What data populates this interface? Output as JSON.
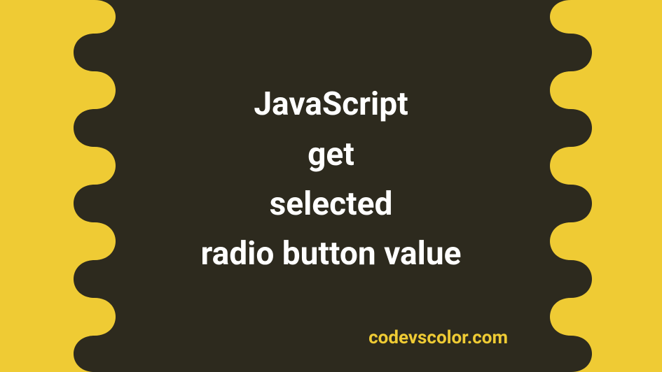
{
  "colors": {
    "background": "#efcb34",
    "blob": "#2d2a1e",
    "title": "#ffffff",
    "site": "#efcb34"
  },
  "title_lines": {
    "l1": "JavaScript",
    "l2": "get",
    "l3": "selected",
    "l4": "radio button value"
  },
  "site": "codevscolor.com"
}
